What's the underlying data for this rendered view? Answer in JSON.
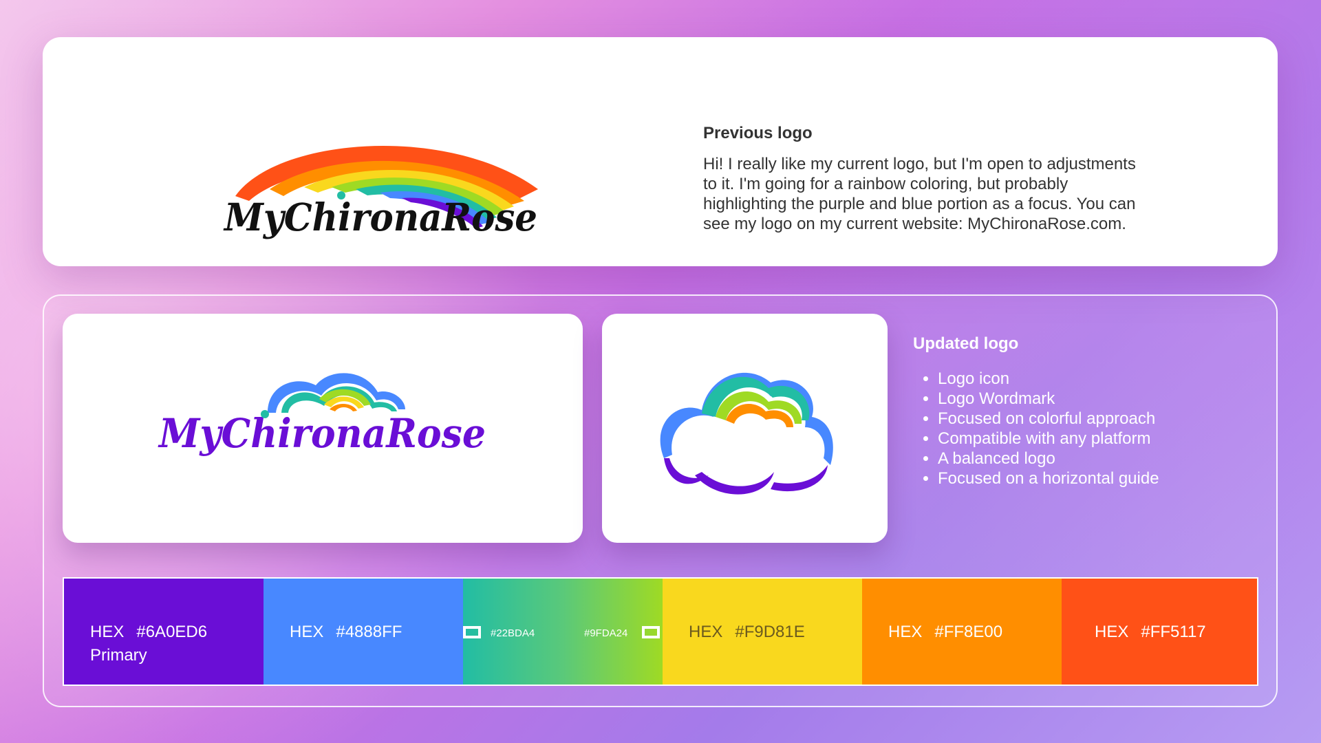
{
  "colors": {
    "purple": "#6A0ED6",
    "blue": "#4888FF",
    "teal": "#22BDA4",
    "green": "#9FDA24",
    "yellow": "#F9D81E",
    "orange": "#FF8E00",
    "red": "#FF5117"
  },
  "previous": {
    "logo_text": "MyChironaRose",
    "title": "Previous logo",
    "body": "Hi! I really like my current logo, but I'm open to adjustments to it. I'm going for a rainbow coloring, but probably highlighting the purple and blue portion as a focus. You can see my logo on my current website: MyChironaRose.com."
  },
  "updated": {
    "logo_text": "MyChironaRose",
    "title": "Updated logo",
    "features": [
      "Logo icon",
      "Logo Wordmark",
      "Focused on colorful approach",
      "Compatible with any platform",
      "A balanced logo",
      "Focused on a horizontal guide"
    ]
  },
  "palette": {
    "hex_label": "HEX",
    "purple": {
      "hex": "#6A0ED6",
      "note": "Primary"
    },
    "blue": {
      "hex": "#4888FF"
    },
    "gradient_start": {
      "hex": "#22BDA4"
    },
    "gradient_end": {
      "hex": "#9FDA24"
    },
    "yellow": {
      "hex": "#F9D81E"
    },
    "orange": {
      "hex": "#FF8E00"
    },
    "red": {
      "hex": "#FF5117"
    }
  }
}
